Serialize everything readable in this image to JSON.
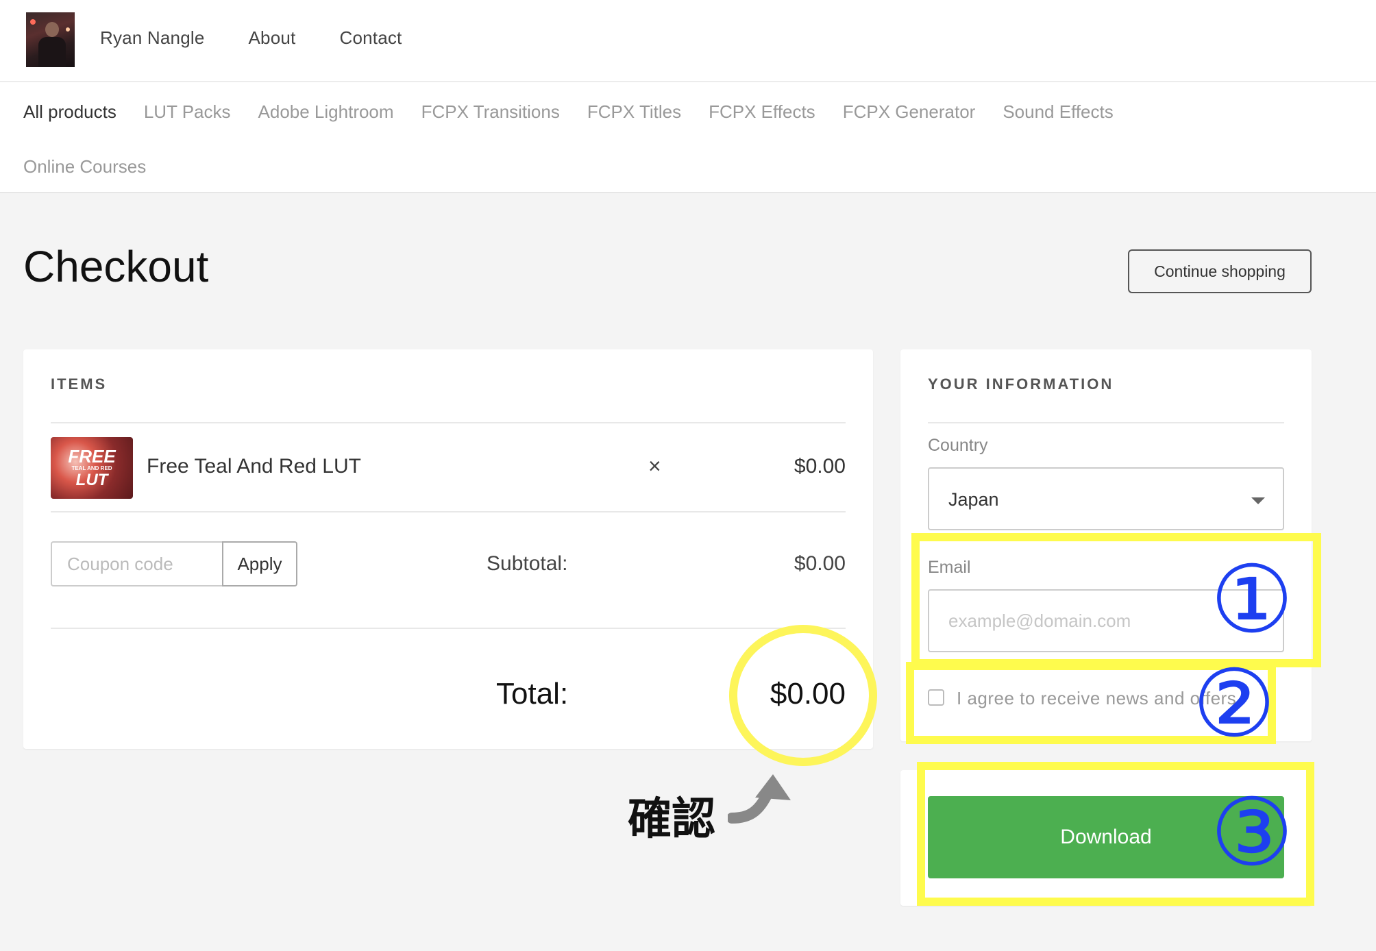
{
  "header": {
    "nav": [
      "Ryan Nangle",
      "About",
      "Contact"
    ]
  },
  "categories": {
    "row1": [
      "All products",
      "LUT Packs",
      "Adobe Lightroom",
      "FCPX Transitions",
      "FCPX Titles",
      "FCPX Effects",
      "FCPX Generator",
      "Sound Effects"
    ],
    "row2": [
      "Online Courses"
    ],
    "active": "All products"
  },
  "page": {
    "title": "Checkout",
    "continue_label": "Continue shopping"
  },
  "items": {
    "heading": "ITEMS",
    "rows": [
      {
        "name": "Free Teal And Red LUT",
        "price": "$0.00",
        "thumb": {
          "line1": "FREE",
          "line2": "TEAL AND RED",
          "line3": "LUT"
        }
      }
    ],
    "remove_icon": "×",
    "coupon_placeholder": "Coupon code",
    "apply_label": "Apply",
    "subtotal_label": "Subtotal:",
    "subtotal_value": "$0.00",
    "total_label": "Total:",
    "total_value": "$0.00"
  },
  "info": {
    "heading": "YOUR INFORMATION",
    "country_label": "Country",
    "country_value": "Japan",
    "email_label": "Email",
    "email_placeholder": "example@domain.com",
    "agree_label": "I agree to receive news and offers"
  },
  "download": {
    "label": "Download"
  },
  "annotations": {
    "step1": "①",
    "step2": "②",
    "step3": "③",
    "confirm": "確認",
    "highlight_color": "#fefb4d",
    "number_color": "#1d3ff0"
  },
  "colors": {
    "download_green": "#4caf50",
    "background": "#f4f4f4"
  }
}
